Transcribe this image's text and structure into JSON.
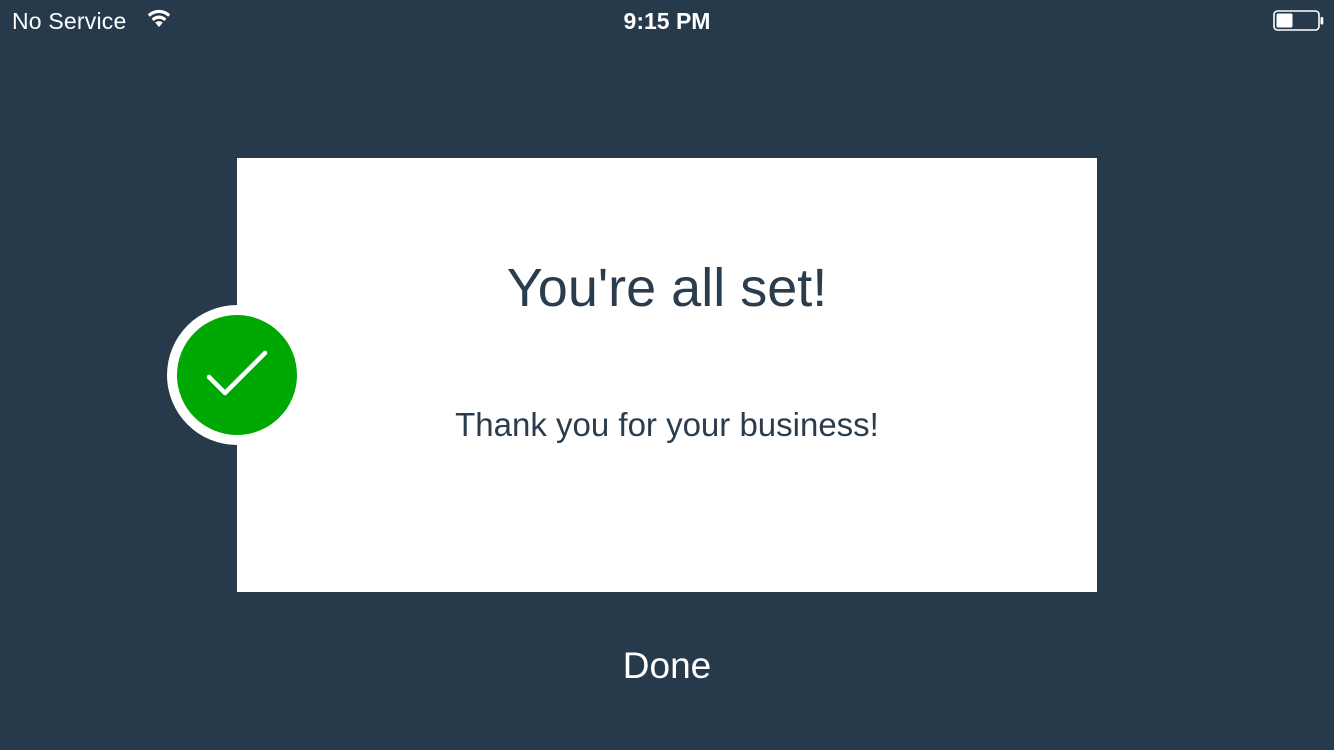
{
  "status_bar": {
    "carrier": "No Service",
    "time": "9:15 PM",
    "wifi_icon": "wifi-icon",
    "battery_icon": "battery-icon",
    "battery_level": 0.4
  },
  "card": {
    "title": "You're all set!",
    "message": "Thank you for your business!",
    "badge_icon": "checkmark-icon"
  },
  "actions": {
    "done_label": "Done"
  },
  "colors": {
    "background": "#263a4b",
    "card": "#ffffff",
    "text_dark": "#2b3d4d",
    "success": "#00a803"
  }
}
